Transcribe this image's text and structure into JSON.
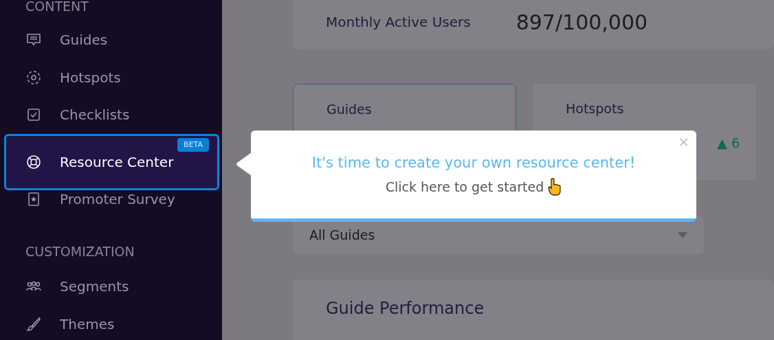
{
  "sidebar": {
    "sections": [
      {
        "title": "CONTENT",
        "items": [
          {
            "label": "Guides",
            "selected": false
          },
          {
            "label": "Hotspots",
            "selected": false
          },
          {
            "label": "Checklists",
            "selected": false
          },
          {
            "label": "Resource Center",
            "selected": true,
            "badge": "BETA"
          },
          {
            "label": "Promoter Survey",
            "selected": false
          }
        ]
      },
      {
        "title": "CUSTOMIZATION",
        "items": [
          {
            "label": "Segments",
            "selected": false
          },
          {
            "label": "Themes",
            "selected": false
          }
        ]
      }
    ]
  },
  "usage": {
    "label": "Monthly Active Users",
    "value": "897/100,000"
  },
  "stat_cards": [
    {
      "label": "Guides",
      "selected": true
    },
    {
      "label": "Hotspots",
      "selected": false,
      "trend": "▲ 6"
    }
  ],
  "filter": {
    "value": "All Guides"
  },
  "panel": {
    "title": "Guide Performance"
  },
  "popup": {
    "title": "It's time to create your own resource center!",
    "text": "Click here to get started",
    "close": "×"
  }
}
